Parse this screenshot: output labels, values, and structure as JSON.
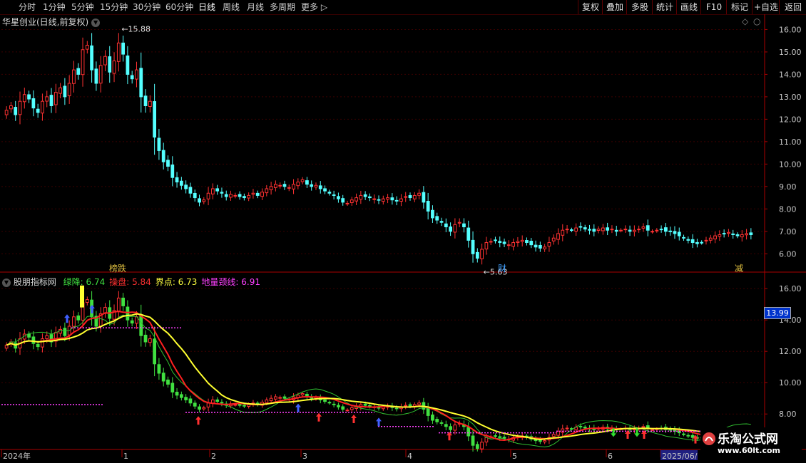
{
  "toolbar": {
    "periods": [
      "分时",
      "1分钟",
      "5分钟",
      "15分钟",
      "30分钟",
      "60分钟",
      "日线",
      "周线",
      "月线",
      "多周期",
      "更多"
    ],
    "active": "日线",
    "right_buttons": [
      "复权",
      "叠加",
      "多股",
      "统计",
      "画线",
      "F10",
      "标记",
      "+自选",
      "返回"
    ]
  },
  "main": {
    "title": "华星创业(日线,前复权)",
    "high_label": "15.88",
    "low_label": "5.63",
    "yticks": [
      "16.00",
      "15.00",
      "14.00",
      "13.00",
      "12.00",
      "11.00",
      "10.00",
      "9.00",
      "8.00",
      "7.00",
      "6.00"
    ],
    "events": [
      {
        "text": "榜跌",
        "color": "#e0c040"
      },
      {
        "text": "财",
        "color": "#40a0ff"
      },
      {
        "text": "减",
        "color": "#e0c040"
      }
    ]
  },
  "indicator": {
    "name": "股朋指标网",
    "legend": [
      {
        "label": "绿降:",
        "value": "6.74",
        "color": "#40e040"
      },
      {
        "label": "操盘:",
        "value": "5.84",
        "color": "#ff3030"
      },
      {
        "label": "界点:",
        "value": "6.73",
        "color": "#ffff40"
      },
      {
        "label": "地量颈线:",
        "value": "6.91",
        "color": "#ff40ff"
      }
    ],
    "yticks": [
      "16.00",
      "14.00",
      "12.00",
      "10.00",
      "8.00"
    ],
    "price_tag": "13.99"
  },
  "xaxis": {
    "labels": [
      "2024年",
      "1",
      "2",
      "3",
      "4",
      "5",
      "6",
      "2025/06/"
    ]
  },
  "watermark": {
    "line1": "乐淘公式网",
    "line2": "www.60lt.com"
  },
  "chart_data": {
    "type": "candlestick",
    "series": [
      {
        "name": "绿降",
        "values": [
          6.74
        ]
      },
      {
        "name": "操盘",
        "values": [
          5.84
        ]
      },
      {
        "name": "界点",
        "values": [
          6.73
        ]
      },
      {
        "name": "地量颈线",
        "values": [
          6.91
        ]
      }
    ],
    "closes": [
      12.4,
      12.6,
      12.2,
      12.8,
      13.1,
      12.9,
      12.5,
      12.3,
      12.8,
      13.0,
      12.6,
      13.2,
      13.4,
      13.0,
      13.6,
      14.2,
      14.0,
      15.1,
      15.3,
      14.2,
      13.6,
      14.4,
      14.8,
      14.1,
      14.6,
      15.4,
      14.9,
      14.0,
      13.8,
      14.2,
      13.0,
      12.6,
      12.8,
      11.2,
      10.6,
      10.1,
      9.9,
      9.4,
      9.2,
      9.05,
      8.9,
      8.7,
      8.5,
      8.3,
      8.4,
      8.7,
      8.9,
      8.8,
      8.7,
      8.55,
      8.65,
      8.6,
      8.55,
      8.5,
      8.6,
      8.7,
      8.6,
      8.75,
      8.9,
      9.0,
      9.1,
      9.05,
      9.0,
      8.95,
      9.1,
      9.2,
      9.3,
      9.1,
      9.0,
      9.05,
      8.9,
      8.8,
      8.7,
      8.6,
      8.45,
      8.3,
      8.25,
      8.4,
      8.5,
      8.6,
      8.55,
      8.5,
      8.45,
      8.4,
      8.45,
      8.5,
      8.4,
      8.35,
      8.45,
      8.55,
      8.5,
      8.6,
      8.7,
      8.3,
      7.9,
      7.6,
      7.5,
      7.4,
      7.2,
      7.0,
      7.3,
      7.4,
      7.2,
      6.6,
      6.0,
      5.8,
      6.2,
      6.5,
      6.55,
      6.6,
      6.5,
      6.45,
      6.4,
      6.5,
      6.55,
      6.6,
      6.5,
      6.4,
      6.3,
      6.25,
      6.3,
      6.5,
      6.7,
      6.9,
      7.05,
      7.1,
      7.05,
      7.15,
      7.2,
      7.1,
      7.05,
      7.0,
      7.1,
      7.15,
      7.05,
      7.1,
      7.0,
      7.05,
      7.1,
      7.0,
      7.05,
      7.1,
      7.2,
      7.05,
      7.0,
      7.05,
      7.1,
      7.0,
      7.0,
      6.9,
      6.8,
      6.7,
      6.6,
      6.5,
      6.45,
      6.5,
      6.6,
      6.7,
      6.8,
      6.85,
      6.9,
      6.95,
      6.85,
      6.8,
      6.85,
      6.9,
      6.85
    ],
    "price_ylim_main": [
      5.5,
      16.3
    ],
    "price_ylim_indicator": [
      6.6,
      16.6
    ],
    "xlabels": [
      "2024年",
      "1",
      "2",
      "3",
      "4",
      "5",
      "6",
      "2025/06/"
    ]
  }
}
